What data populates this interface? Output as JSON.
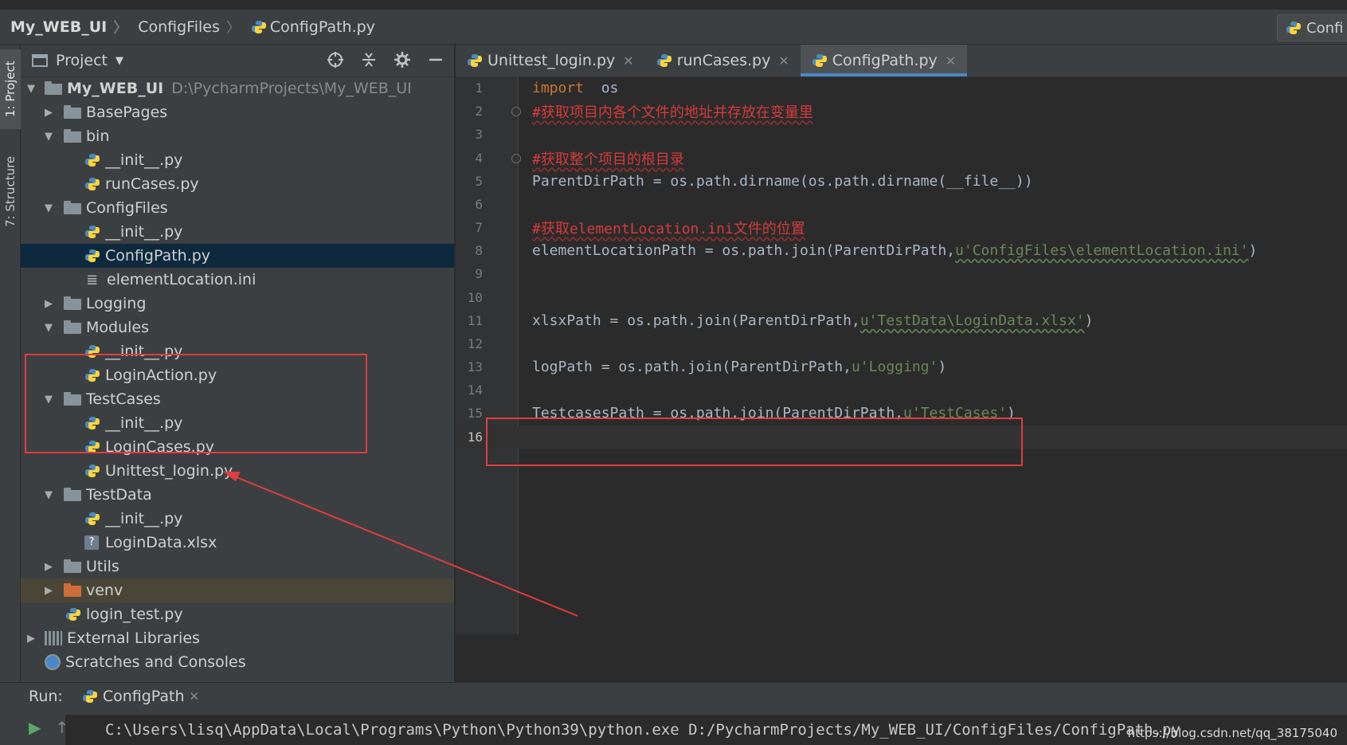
{
  "navbar": {
    "breadcrumbs": [
      "My_WEB_UI",
      "ConfigFiles",
      "ConfigPath.py"
    ],
    "run_config_label": "Confi"
  },
  "left_strip": {
    "project_tab": "1: Project",
    "structure_tab": "7: Structure"
  },
  "project_panel": {
    "title": "Project",
    "tree": [
      {
        "label": "My_WEB_UI",
        "hint": "D:\\PycharmProjects\\My_WEB_UI"
      },
      {
        "label": "BasePages"
      },
      {
        "label": "bin"
      },
      {
        "label": "__init__.py"
      },
      {
        "label": "runCases.py"
      },
      {
        "label": "ConfigFiles"
      },
      {
        "label": "__init__.py"
      },
      {
        "label": "ConfigPath.py"
      },
      {
        "label": "elementLocation.ini"
      },
      {
        "label": "Logging"
      },
      {
        "label": "Modules"
      },
      {
        "label": "__init__.py"
      },
      {
        "label": "LoginAction.py"
      },
      {
        "label": "TestCases"
      },
      {
        "label": "__init__.py"
      },
      {
        "label": "LoginCases.py"
      },
      {
        "label": "Unittest_login.py"
      },
      {
        "label": "TestData"
      },
      {
        "label": "__init__.py"
      },
      {
        "label": "LoginData.xlsx"
      },
      {
        "label": "Utils"
      },
      {
        "label": "venv"
      },
      {
        "label": "login_test.py"
      },
      {
        "label": "External Libraries"
      },
      {
        "label": "Scratches and Consoles"
      }
    ]
  },
  "editor": {
    "tabs": [
      "Unittest_login.py",
      "runCases.py",
      "ConfigPath.py"
    ],
    "active_tab": "ConfigPath.py",
    "lines": [
      {
        "n": "1",
        "parts": [
          "import",
          "  os"
        ]
      },
      {
        "n": "2",
        "parts": [
          "#获取项目内各个文件的地址并存放在变量里"
        ]
      },
      {
        "n": "3",
        "parts": []
      },
      {
        "n": "4",
        "parts": [
          "#获取整个项目的根目录"
        ]
      },
      {
        "n": "5",
        "parts": [
          "ParentDirPath = os.path.dirname(os.path.dirname(__file__))"
        ]
      },
      {
        "n": "6",
        "parts": []
      },
      {
        "n": "7",
        "parts": [
          "#获取elementLocation.ini文件的位置"
        ]
      },
      {
        "n": "8",
        "parts": [
          "elementLocationPath = os.path.join(ParentDirPath,",
          "u'ConfigFiles\\elementLocation.ini'",
          ")"
        ]
      },
      {
        "n": "9",
        "parts": []
      },
      {
        "n": "10",
        "parts": []
      },
      {
        "n": "11",
        "parts": [
          "xlsxPath = os.path.join(ParentDirPath,",
          "u'TestData\\LoginData.xlsx'",
          ")"
        ]
      },
      {
        "n": "12",
        "parts": []
      },
      {
        "n": "13",
        "parts": [
          "logPath = os.path.join(ParentDirPath,",
          "u'Logging'",
          ")"
        ]
      },
      {
        "n": "14",
        "parts": []
      },
      {
        "n": "15",
        "parts": [
          "TestcasesPath = os.path.join(ParentDirPath,",
          "u'TestCases'",
          ")"
        ]
      },
      {
        "n": "16",
        "parts": []
      }
    ]
  },
  "run": {
    "label": "Run:",
    "config_tab": "ConfigPath",
    "console_line": "C:\\Users\\lisq\\AppData\\Local\\Programs\\Python\\Python39\\python.exe D:/PycharmProjects/My_WEB_UI/ConfigFiles/ConfigPath.py"
  },
  "watermark": "https://blog.csdn.net/qq_38175040",
  "colors": {
    "highlight_box": "#e23c3c",
    "selection": "#0d293e",
    "keyword": "#cc7832",
    "string": "#6a8759",
    "comment": "#d63a3a"
  }
}
